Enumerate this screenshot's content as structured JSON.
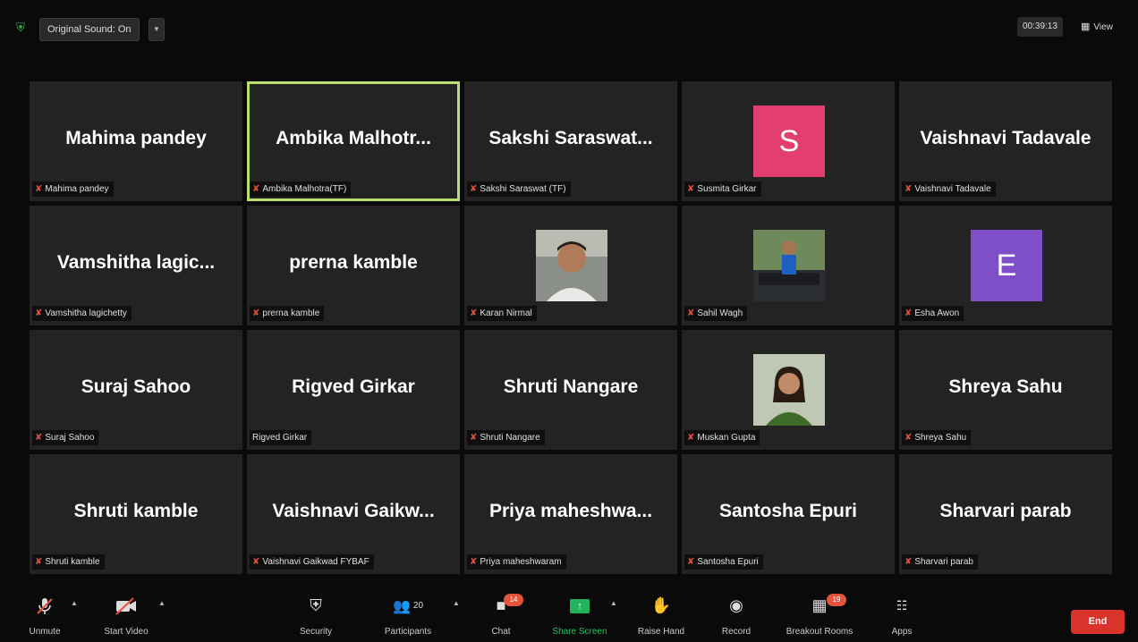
{
  "topbar": {
    "sound_label": "Original Sound: On",
    "timer": "00:39:13",
    "view_label": "View"
  },
  "tiles": [
    {
      "big": "Mahima pandey",
      "label": "Mahima pandey",
      "muted": true
    },
    {
      "big": "Ambika  Malhotr...",
      "label": "Ambika Malhotra(TF)",
      "muted": true,
      "active": true
    },
    {
      "big": "Sakshi  Saraswat...",
      "label": "Sakshi Saraswat (TF)",
      "muted": true
    },
    {
      "avatar_letter": "S",
      "avatar_color": "#e23e6f",
      "label": "Susmita Girkar",
      "muted": true
    },
    {
      "big": "Vaishnavi Tadavale",
      "label": "Vaishnavi Tadavale",
      "muted": true
    },
    {
      "big": "Vamshitha  lagic...",
      "label": "Vamshitha lagichetty",
      "muted": true
    },
    {
      "big": "prerna kamble",
      "label": "prerna kamble",
      "muted": true
    },
    {
      "photo": "person-1",
      "label": "Karan Nirmal",
      "muted": true
    },
    {
      "photo": "person-2",
      "label": "Sahil Wagh",
      "muted": true
    },
    {
      "avatar_letter": "E",
      "avatar_color": "#7e4fc8",
      "label": "Esha Awon",
      "muted": true
    },
    {
      "big": "Suraj Sahoo",
      "label": "Suraj Sahoo",
      "muted": true
    },
    {
      "big": "Rigved Girkar",
      "label": "Rigved Girkar",
      "muted": false
    },
    {
      "big": "Shruti Nangare",
      "label": "Shruti Nangare",
      "muted": true
    },
    {
      "photo": "person-3",
      "label": "Muskan Gupta",
      "muted": true
    },
    {
      "big": "Shreya Sahu",
      "label": "Shreya Sahu",
      "muted": true
    },
    {
      "big": "Shruti kamble",
      "label": "Shruti kamble",
      "muted": true
    },
    {
      "big": "Vaishnavi  Gaikw...",
      "label": "Vaishnavi Gaikwad FYBAF",
      "muted": true
    },
    {
      "big": "Priya  maheshwa...",
      "label": "Priya maheshwaram",
      "muted": true
    },
    {
      "big": "Santosha Epuri",
      "label": "Santosha Epuri",
      "muted": true
    },
    {
      "big": "Sharvari parab",
      "label": "Sharvari parab",
      "muted": true
    }
  ],
  "toolbar": {
    "unmute": "Unmute",
    "start_video": "Start Video",
    "security": "Security",
    "participants": "Participants",
    "participants_count": "20",
    "chat": "Chat",
    "chat_badge": "14",
    "share_screen": "Share Screen",
    "raise_hand": "Raise Hand",
    "record": "Record",
    "breakout_rooms": "Breakout Rooms",
    "breakout_badge": "19",
    "apps": "Apps",
    "end": "End"
  },
  "colors": {
    "active_border": "#b8e06a",
    "share_green": "#21b35a",
    "end_red": "#d9332b",
    "mic_off_red": "#e5533d"
  }
}
